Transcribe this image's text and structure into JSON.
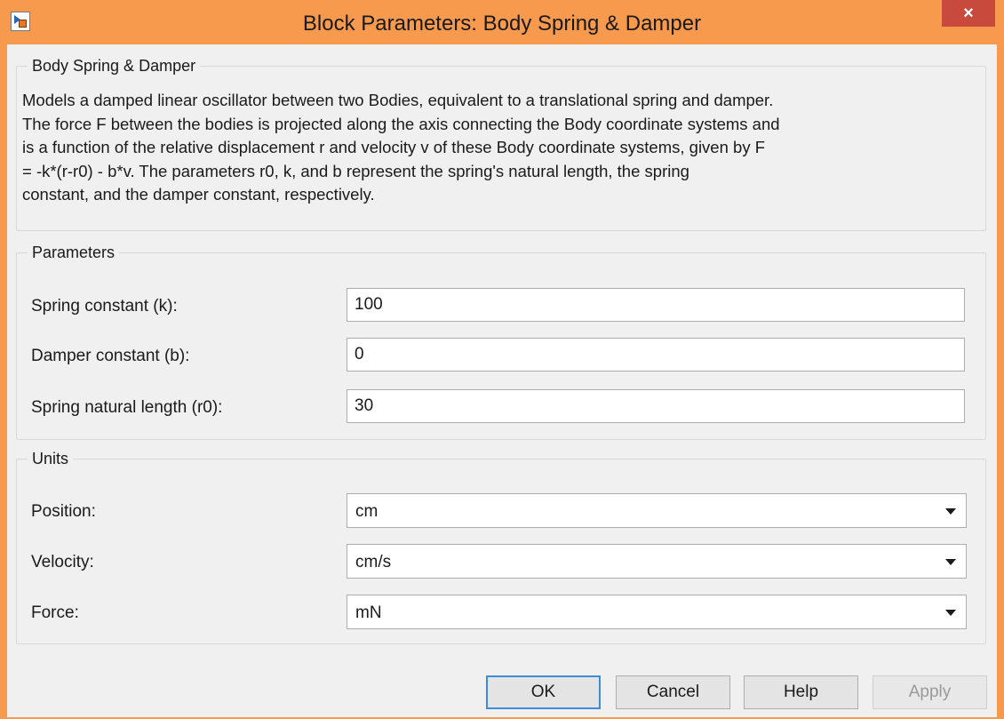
{
  "window": {
    "title": "Block Parameters: Body Spring & Damper",
    "close_glyph": "×",
    "icon": "simulink-block-icon"
  },
  "description": {
    "group_title": "Body Spring & Damper",
    "lines": [
      "Models a damped linear oscillator between two Bodies, equivalent to a translational spring and damper.",
      "The force F between the bodies is projected along the axis connecting the Body coordinate systems and",
      "is a function of the relative displacement r and velocity v of these Body coordinate systems, given by F",
      "= -k*(r-r0) - b*v. The parameters r0, k, and b represent the spring's natural length, the spring",
      "constant, and the damper constant, respectively."
    ]
  },
  "parameters": {
    "group_title": "Parameters",
    "fields": [
      {
        "label": "Spring constant (k):",
        "value": "100"
      },
      {
        "label": "Damper constant (b):",
        "value": "0"
      },
      {
        "label": "Spring natural length (r0):",
        "value": "30"
      }
    ]
  },
  "units": {
    "group_title": "Units",
    "fields": [
      {
        "label": "Position:",
        "value": "cm"
      },
      {
        "label": "Velocity:",
        "value": "cm/s"
      },
      {
        "label": "Force:",
        "value": "mN"
      }
    ]
  },
  "buttons": {
    "ok": "OK",
    "cancel": "Cancel",
    "help": "Help",
    "apply": "Apply"
  },
  "colors": {
    "frame": "#f79a4d",
    "close": "#c74a3c",
    "dialog_bg": "#f0f0f0",
    "default_button_border": "#3c8cd8"
  }
}
